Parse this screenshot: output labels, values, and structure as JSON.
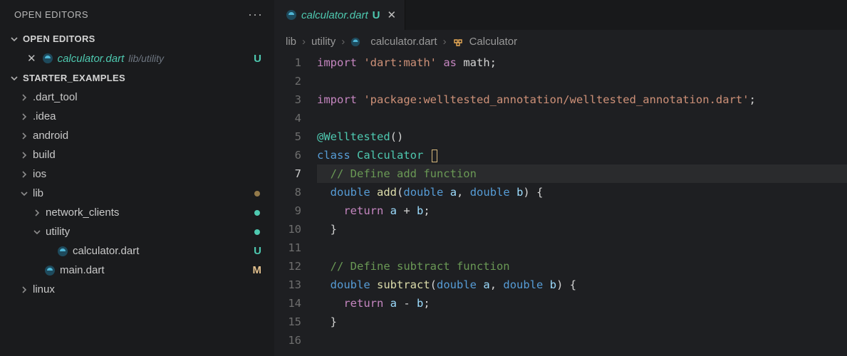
{
  "sidebar": {
    "headerTitle": "OPEN EDITORS",
    "sections": {
      "openEditors": {
        "title": "OPEN EDITORS",
        "items": [
          {
            "name": "calculator.dart",
            "path": "lib/utility",
            "status": "U"
          }
        ]
      },
      "project": {
        "title": "STARTER_EXAMPLES",
        "tree": [
          {
            "label": ".dart_tool",
            "kind": "folder",
            "expanded": false,
            "depth": 0
          },
          {
            "label": ".idea",
            "kind": "folder",
            "expanded": false,
            "depth": 0
          },
          {
            "label": "android",
            "kind": "folder",
            "expanded": false,
            "depth": 0
          },
          {
            "label": "build",
            "kind": "folder",
            "expanded": false,
            "depth": 0
          },
          {
            "label": "ios",
            "kind": "folder",
            "expanded": false,
            "depth": 0
          },
          {
            "label": "lib",
            "kind": "folder",
            "expanded": true,
            "depth": 0,
            "dot": "brown"
          },
          {
            "label": "network_clients",
            "kind": "folder",
            "expanded": false,
            "depth": 1,
            "color": "green",
            "dot": "green"
          },
          {
            "label": "utility",
            "kind": "folder",
            "expanded": true,
            "depth": 1,
            "color": "green",
            "dot": "green"
          },
          {
            "label": "calculator.dart",
            "kind": "file-dart",
            "depth": 2,
            "color": "green",
            "status": "U"
          },
          {
            "label": "main.dart",
            "kind": "file-dart",
            "depth": 1,
            "color": "yellow",
            "status": "M"
          },
          {
            "label": "linux",
            "kind": "folder",
            "expanded": false,
            "depth": 0
          }
        ]
      }
    }
  },
  "editor": {
    "tab": {
      "name": "calculator.dart",
      "status": "U"
    },
    "breadcrumb": [
      "lib",
      "utility",
      "calculator.dart",
      "Calculator"
    ],
    "activeLine": 7,
    "lines": [
      [
        {
          "t": "kw",
          "v": "import"
        },
        {
          "t": "p",
          "v": " "
        },
        {
          "t": "str",
          "v": "'dart:math'"
        },
        {
          "t": "p",
          "v": " "
        },
        {
          "t": "kw",
          "v": "as"
        },
        {
          "t": "p",
          "v": " math;"
        }
      ],
      [],
      [
        {
          "t": "kw",
          "v": "import"
        },
        {
          "t": "p",
          "v": " "
        },
        {
          "t": "str",
          "v": "'package:welltested_annotation/welltested_annotation.dart'"
        },
        {
          "t": "p",
          "v": ";"
        }
      ],
      [],
      [
        {
          "t": "anno",
          "v": "@Welltested"
        },
        {
          "t": "p",
          "v": "()"
        }
      ],
      [
        {
          "t": "type",
          "v": "class"
        },
        {
          "t": "p",
          "v": " "
        },
        {
          "t": "class",
          "v": "Calculator"
        },
        {
          "t": "p",
          "v": " "
        },
        {
          "t": "cursor",
          "v": "{"
        }
      ],
      [
        {
          "t": "indent",
          "v": "  "
        },
        {
          "t": "comment",
          "v": "// Define add function"
        }
      ],
      [
        {
          "t": "indent",
          "v": "  "
        },
        {
          "t": "type",
          "v": "double"
        },
        {
          "t": "p",
          "v": " "
        },
        {
          "t": "fn",
          "v": "add"
        },
        {
          "t": "p",
          "v": "("
        },
        {
          "t": "type",
          "v": "double"
        },
        {
          "t": "p",
          "v": " "
        },
        {
          "t": "param",
          "v": "a"
        },
        {
          "t": "p",
          "v": ", "
        },
        {
          "t": "type",
          "v": "double"
        },
        {
          "t": "p",
          "v": " "
        },
        {
          "t": "param",
          "v": "b"
        },
        {
          "t": "p",
          "v": ") {"
        }
      ],
      [
        {
          "t": "indent",
          "v": "    "
        },
        {
          "t": "kw",
          "v": "return"
        },
        {
          "t": "p",
          "v": " "
        },
        {
          "t": "param",
          "v": "a"
        },
        {
          "t": "p",
          "v": " + "
        },
        {
          "t": "param",
          "v": "b"
        },
        {
          "t": "p",
          "v": ";"
        }
      ],
      [
        {
          "t": "indent",
          "v": "  "
        },
        {
          "t": "p",
          "v": "}"
        }
      ],
      [],
      [
        {
          "t": "indent",
          "v": "  "
        },
        {
          "t": "comment",
          "v": "// Define subtract function"
        }
      ],
      [
        {
          "t": "indent",
          "v": "  "
        },
        {
          "t": "type",
          "v": "double"
        },
        {
          "t": "p",
          "v": " "
        },
        {
          "t": "fn",
          "v": "subtract"
        },
        {
          "t": "p",
          "v": "("
        },
        {
          "t": "type",
          "v": "double"
        },
        {
          "t": "p",
          "v": " "
        },
        {
          "t": "param",
          "v": "a"
        },
        {
          "t": "p",
          "v": ", "
        },
        {
          "t": "type",
          "v": "double"
        },
        {
          "t": "p",
          "v": " "
        },
        {
          "t": "param",
          "v": "b"
        },
        {
          "t": "p",
          "v": ") {"
        }
      ],
      [
        {
          "t": "indent",
          "v": "    "
        },
        {
          "t": "kw",
          "v": "return"
        },
        {
          "t": "p",
          "v": " "
        },
        {
          "t": "param",
          "v": "a"
        },
        {
          "t": "p",
          "v": " - "
        },
        {
          "t": "param",
          "v": "b"
        },
        {
          "t": "p",
          "v": ";"
        }
      ],
      [
        {
          "t": "indent",
          "v": "  "
        },
        {
          "t": "p",
          "v": "}"
        }
      ],
      []
    ]
  }
}
